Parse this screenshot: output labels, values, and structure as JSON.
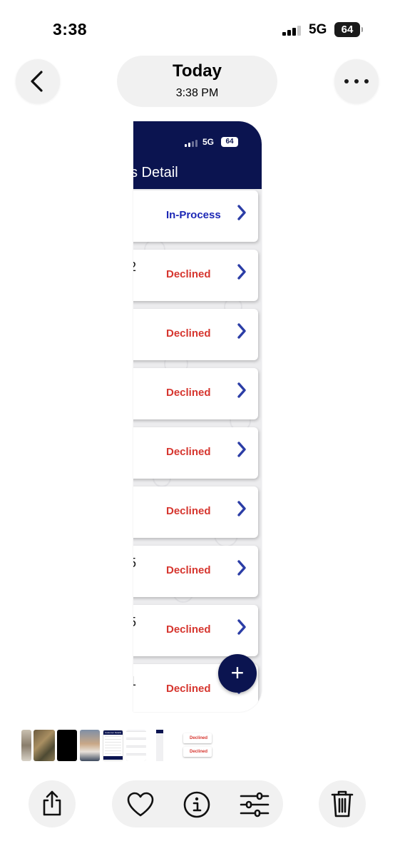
{
  "status_bar": {
    "time": "3:38",
    "network": "5G",
    "battery": "64"
  },
  "nav": {
    "title": "Today",
    "subtitle": "3:38 PM"
  },
  "preview": {
    "status": {
      "network": "5G",
      "battery": "64"
    },
    "header_title": "s Detail",
    "cards": [
      {
        "id": "",
        "status": "In-Process",
        "kind": "process"
      },
      {
        "id": "2",
        "status": "Declined",
        "kind": "declined"
      },
      {
        "id": "'",
        "status": "Declined",
        "kind": "declined"
      },
      {
        "id": "",
        "status": "Declined",
        "kind": "declined"
      },
      {
        "id": "'",
        "status": "Declined",
        "kind": "declined"
      },
      {
        "id": "",
        "status": "Declined",
        "kind": "declined"
      },
      {
        "id": "5",
        "status": "Declined",
        "kind": "declined"
      },
      {
        "id": "5",
        "status": "Declined",
        "kind": "declined"
      },
      {
        "id": "1",
        "status": "Declined",
        "kind": "declined"
      }
    ],
    "fab_label": "+"
  },
  "thumbnails": {
    "mini_header": "Customer Details",
    "declined_label": "Declined"
  },
  "colors": {
    "header": "#0b1450",
    "process": "#1c27b5",
    "declined": "#d6362f",
    "chevron": "#2b3da6"
  },
  "icons": {
    "back": "chevron-left-icon",
    "more": "ellipsis-icon",
    "share": "share-icon",
    "favorite": "heart-icon",
    "info": "info-icon",
    "adjust": "sliders-icon",
    "delete": "trash-icon"
  }
}
